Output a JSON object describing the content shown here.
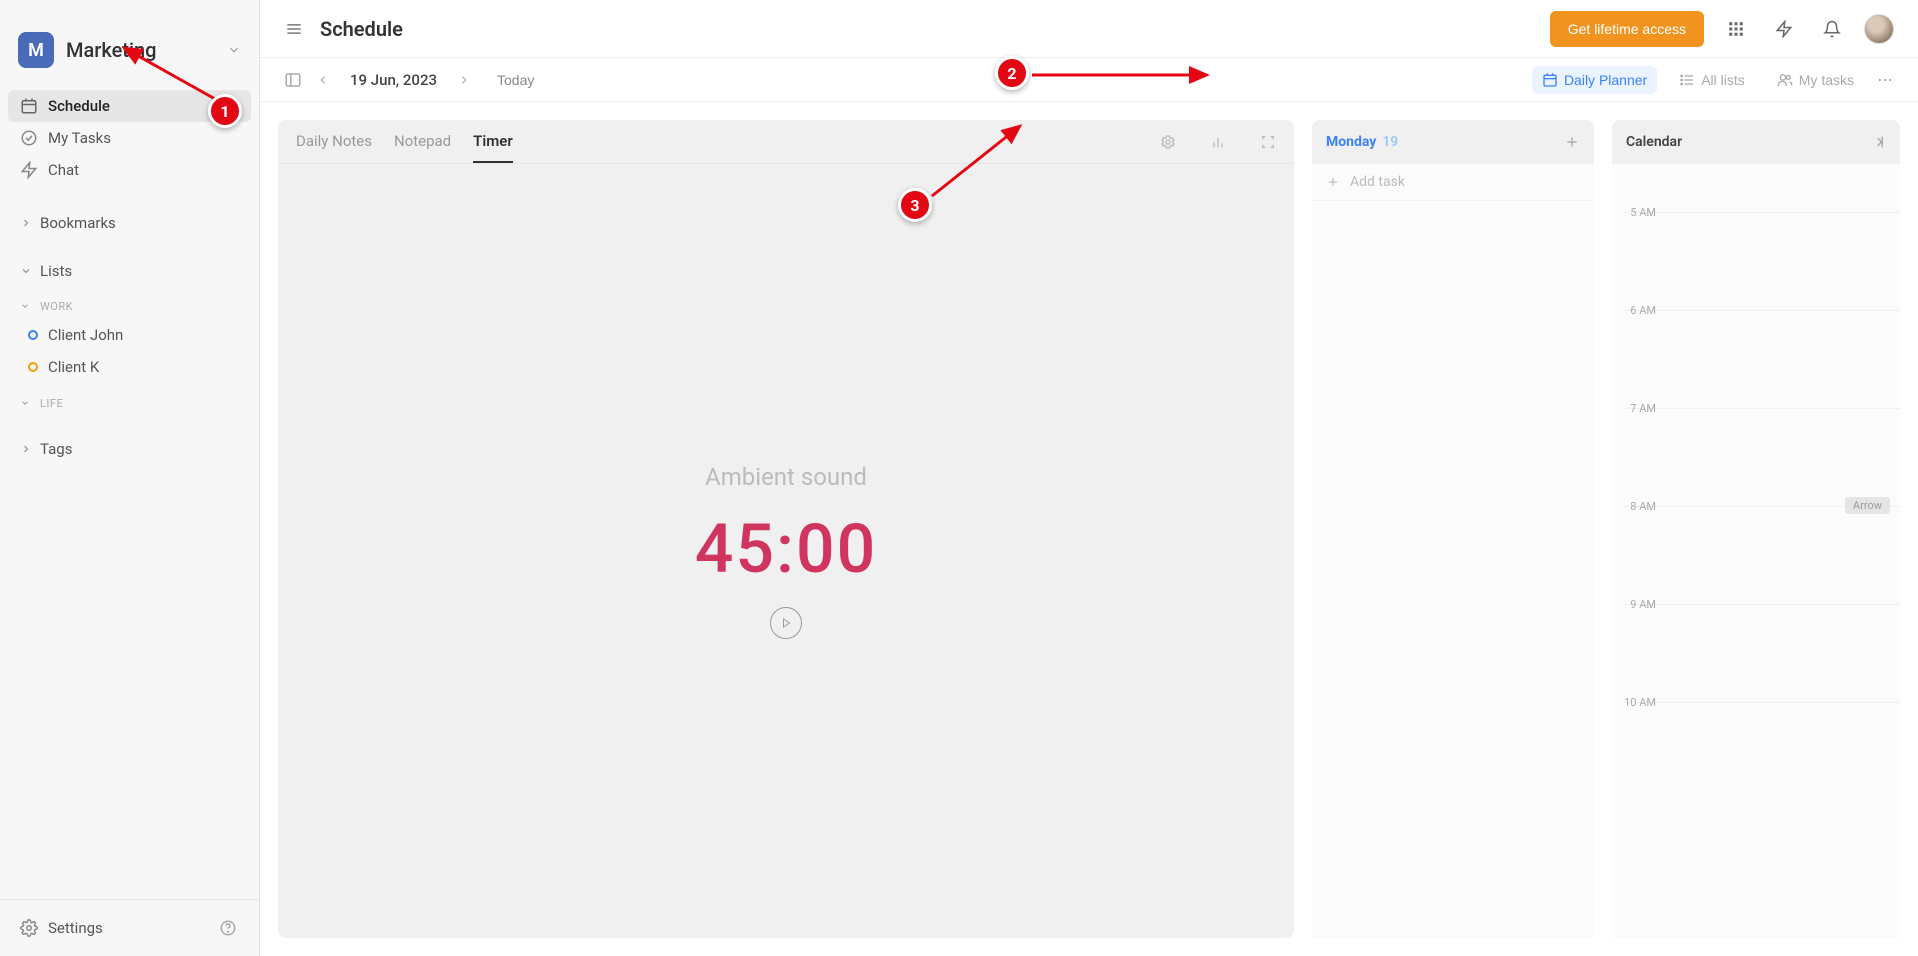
{
  "workspace": {
    "initial": "M",
    "name": "Marketing"
  },
  "sidebar": {
    "nav": {
      "schedule": "Schedule",
      "my_tasks": "My Tasks",
      "chat": "Chat"
    },
    "bookmarks_label": "Bookmarks",
    "lists_label": "Lists",
    "work_group": "WORK",
    "clients": [
      {
        "name": "Client John",
        "color": "#3b82f6"
      },
      {
        "name": "Client K",
        "color": "#f59e0b"
      }
    ],
    "life_group": "LIFE",
    "tags_label": "Tags",
    "settings_label": "Settings"
  },
  "header": {
    "title": "Schedule",
    "cta": "Get lifetime access"
  },
  "toolbar": {
    "date": "19 Jun, 2023",
    "today": "Today",
    "views": {
      "daily_planner": "Daily Planner",
      "all_lists": "All lists",
      "my_tasks": "My tasks"
    }
  },
  "left_panel": {
    "tabs": {
      "daily_notes": "Daily Notes",
      "notepad": "Notepad",
      "timer": "Timer"
    },
    "timer": {
      "ambient_label": "Ambient sound",
      "value": "45:00"
    }
  },
  "mid_panel": {
    "day_name": "Monday",
    "day_number": "19",
    "add_task_placeholder": "Add task"
  },
  "right_panel": {
    "title": "Calendar",
    "hours": [
      "5 AM",
      "6 AM",
      "7 AM",
      "8 AM",
      "9 AM",
      "10 AM"
    ],
    "arrow_badge": "Arrow"
  },
  "annotations": {
    "step1": "1",
    "step2": "2",
    "step3": "3"
  }
}
